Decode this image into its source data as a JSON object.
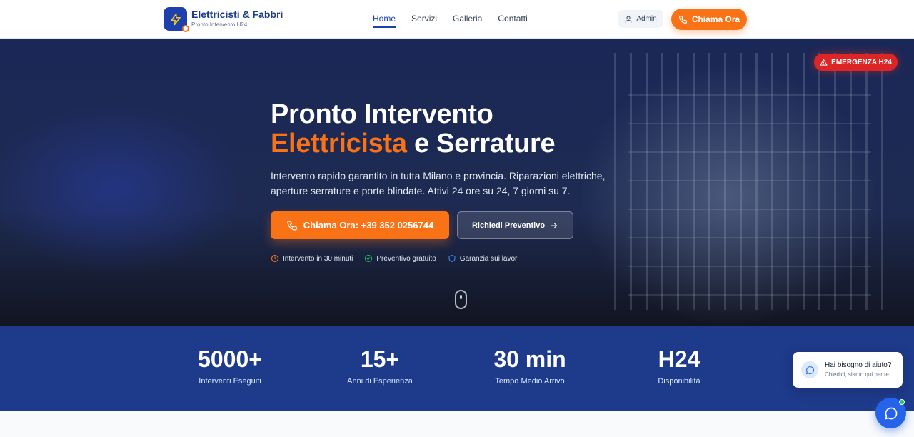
{
  "colors": {
    "primary": "#1e40af",
    "accent": "#f97316",
    "danger": "#dc2626",
    "stats_bg": "#1e3a8a"
  },
  "header": {
    "brand": "Elettricisti & Fabbri",
    "tagline": "Pronto Intervento H24",
    "logo_icon": "lightning-icon",
    "nav": [
      {
        "label": "Home",
        "active": true
      },
      {
        "label": "Servizi",
        "active": false
      },
      {
        "label": "Galleria",
        "active": false
      },
      {
        "label": "Contatti",
        "active": false
      }
    ],
    "admin_label": "Admin",
    "call_label": "Chiama Ora"
  },
  "hero": {
    "emergency_badge": "EMERGENZA H24",
    "title_line1": "Pronto Intervento",
    "title_accent": "Elettricista",
    "title_rest": " e Serrature",
    "subtitle": "Intervento rapido garantito in tutta Milano e provincia. Riparazioni elettriche, aperture serrature e porte blindate. Attivi 24 ore su 24, 7 giorni su 7.",
    "call_button": "Chiama Ora: +39 352 0256744",
    "quote_button": "Richiedi Preventivo",
    "features": [
      {
        "label": "Intervento in 30 minuti",
        "icon": "clock-icon"
      },
      {
        "label": "Preventivo gratuito",
        "icon": "check-circle-icon"
      },
      {
        "label": "Garanzia sui lavori",
        "icon": "shield-icon"
      }
    ]
  },
  "stats": [
    {
      "value": "5000+",
      "label": "Interventi Eseguiti"
    },
    {
      "value": "15+",
      "label": "Anni di Esperienza"
    },
    {
      "value": "30 min",
      "label": "Tempo Medio Arrivo"
    },
    {
      "value": "H24",
      "label": "Disponibilità"
    }
  ],
  "help": {
    "title": "Hai bisogno di aiuto?",
    "subtitle": "Chiedici, siamo qui per te"
  }
}
